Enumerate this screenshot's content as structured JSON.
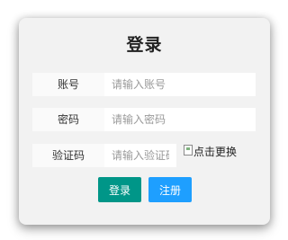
{
  "title": "登录",
  "form": {
    "account": {
      "label": "账号",
      "placeholder": "请输入账号",
      "value": ""
    },
    "password": {
      "label": "密码",
      "placeholder": "请输入密码",
      "value": ""
    },
    "captcha": {
      "label": "验证码",
      "placeholder": "请输入验证码",
      "value": "",
      "image_alt": "点击更换"
    }
  },
  "buttons": {
    "login": "登录",
    "register": "注册"
  },
  "colors": {
    "login_button": "#009688",
    "register_button": "#1e9fff",
    "card_background": "#f2f2f2"
  },
  "icons": {
    "captcha_image": "broken-image-icon"
  }
}
